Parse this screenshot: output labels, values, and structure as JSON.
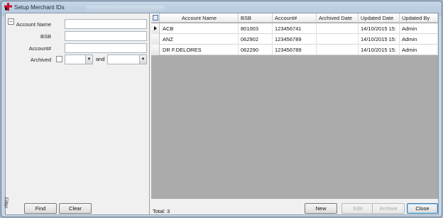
{
  "window": {
    "title": "Setup Merchant IDs",
    "app_icon": "red-cross-icon",
    "accent_color": "#c8102e"
  },
  "filter": {
    "tab_label": "Filter",
    "collapse_glyph": "−",
    "fields": {
      "account_name": {
        "label": "Account Name",
        "value": ""
      },
      "bsb": {
        "label": "BSB",
        "value": ""
      },
      "account_no": {
        "label": "Account#",
        "value": ""
      },
      "archived": {
        "label": "Archived",
        "and_label": "and",
        "from": "",
        "to": ""
      }
    },
    "find_label": "Find",
    "clear_label": "Clear"
  },
  "grid": {
    "columns": [
      "Account Name",
      "BSB",
      "Account#",
      "Archived Date",
      "Updated Date",
      "Updated By"
    ],
    "rows": [
      {
        "account_name": "ACB",
        "bsb": "801003",
        "account_no": "123456741",
        "archived_date": "",
        "updated_date": "14/10/2015 15:",
        "updated_by": "Admin",
        "current": true
      },
      {
        "account_name": "ANZ",
        "bsb": "062902",
        "account_no": "123456789",
        "archived_date": "",
        "updated_date": "14/10/2015 15:",
        "updated_by": "Admin",
        "current": false
      },
      {
        "account_name": "DR F.DELORES",
        "bsb": "062290",
        "account_no": "123456789",
        "archived_date": "",
        "updated_date": "14/10/2015 15:",
        "updated_by": "Admin",
        "current": false
      }
    ]
  },
  "footer": {
    "total_label": "Total: 3",
    "new_label": "New",
    "edit_label": "Edit",
    "archive_label": "Archive",
    "close_label": "Close"
  }
}
